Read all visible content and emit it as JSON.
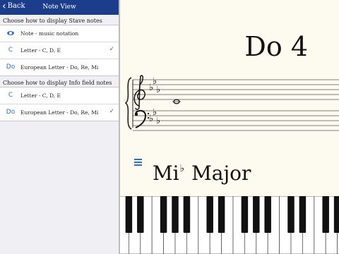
{
  "nav": {
    "back_label": "Back",
    "title": "Note View"
  },
  "stave_section": {
    "header": "Choose how to display Stave notes",
    "options": [
      {
        "icon": "eye-icon",
        "icon_text": "",
        "label": "Note - music notation",
        "checked": false
      },
      {
        "icon": "letter-c-icon",
        "icon_text": "C",
        "label": "Letter - C, D, E",
        "checked": true
      },
      {
        "icon": "do-icon",
        "icon_text": "Do",
        "label": "European Letter - Do, Re, Mi",
        "checked": false
      }
    ]
  },
  "info_section": {
    "header": "Choose how to display Info field notes",
    "options": [
      {
        "icon": "letter-c-icon",
        "icon_text": "C",
        "label": "Letter - C, D, E",
        "checked": false
      },
      {
        "icon": "do-icon",
        "icon_text": "Do",
        "label": "European Letter - Do, Re, Mi",
        "checked": true
      }
    ]
  },
  "checkmark": "✓",
  "note_display": {
    "title": "Do 4",
    "note_marker": "C"
  },
  "key": {
    "note": "Mi",
    "accidental": "♭",
    "mode": "Major",
    "flats": 3
  },
  "keyboard": {
    "white_keys": 29,
    "highlighted_white_key_index": 21
  },
  "colors": {
    "accent": "#2a6dd6",
    "navbar": "#1c3d8c",
    "highlight": "#b08a6a",
    "paper": "#fdfbef"
  }
}
